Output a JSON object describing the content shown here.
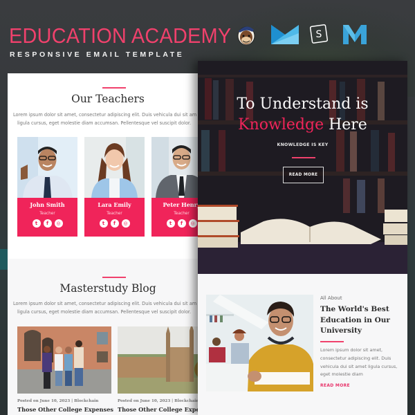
{
  "banner": {
    "title": "EDUCATION ACADEMY",
    "subtitle": "RESPONSIVE EMAIL TEMPLATE",
    "logos": [
      "mailchimp-logo",
      "campaign-monitor-logo",
      "stampready-logo",
      "mailster-logo"
    ],
    "accent_color": "#f0416c"
  },
  "left_panel": {
    "teachers_section": {
      "title": "Our Teachers",
      "description_lines": [
        "Lorem ipsum dolor sit amet, consectetur adipiscing elit. Duis vehicula dui sit am",
        "ligula cursus, eget molestie diam accumsan. Pellentesque vel suscipit dolor."
      ],
      "teachers": [
        {
          "name": "John Smith",
          "role": "Teacher"
        },
        {
          "name": "Lara Emily",
          "role": "Teacher"
        },
        {
          "name": "Peter Henry",
          "role": "Teacher"
        }
      ],
      "social_icons": [
        "twitter-icon",
        "facebook-icon",
        "instagram-icon"
      ],
      "card_color": "#f0245a"
    },
    "blog_section": {
      "title": "Masterstudy Blog",
      "description_lines": [
        "Lorem ipsum dolor sit amet, consectetur adipiscing elit. Duis vehicula dui sit am",
        "ligula cursus, eget molestie diam accumsan. Pellentesque vel suscipit dolor."
      ],
      "posts": [
        {
          "meta": "Posted on June 10, 2023 | Blockchain",
          "title": "Those Other College Expenses"
        },
        {
          "meta": "Posted on June 10, 2023 | Blockchain",
          "title": "Those Other College Expenses"
        }
      ]
    }
  },
  "right_panel": {
    "hero": {
      "title_line1": "To Understand is",
      "title_accent": "Knowledge",
      "title_line2_rest": " Here",
      "subtitle": "KNOWLEDGE IS KEY",
      "button_label": "READ MORE"
    },
    "feature": {
      "label": "All About",
      "title": "The World's Best Education in Our University",
      "description": "Lorem ipsum dolor sit amet, consectetur adipiscing elit. Duis vehicula dui sit amet ligula cursus, eget molestie diam",
      "link_label": "READ MORE"
    }
  }
}
